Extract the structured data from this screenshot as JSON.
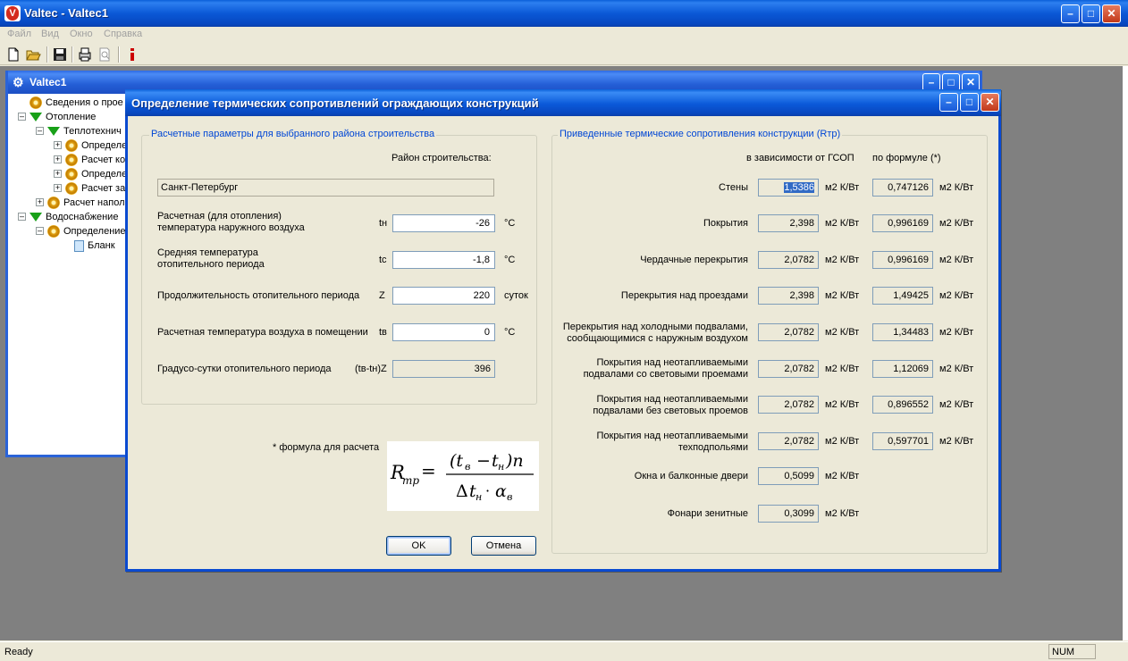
{
  "app": {
    "title": "Valtec - Valtec1",
    "menu": [
      "Файл",
      "Вид",
      "Окно",
      "Справка"
    ],
    "status_ready": "Ready",
    "status_num": "NUM"
  },
  "child": {
    "title": "Valtec1",
    "tree": [
      {
        "label": "Сведения о прое",
        "icon": "gear-icon"
      },
      {
        "label": "Отопление",
        "icon": "triangle-icon"
      },
      {
        "label": "Теплотехнич",
        "icon": "triangle-icon"
      },
      {
        "label": "Определе",
        "icon": "gear-icon"
      },
      {
        "label": "Расчет ко",
        "icon": "gear-icon"
      },
      {
        "label": "Определе",
        "icon": "gear-icon"
      },
      {
        "label": "Расчет за",
        "icon": "gear-icon"
      },
      {
        "label": "Расчет напол",
        "icon": "gear-icon"
      },
      {
        "label": "Водоснабжение",
        "icon": "triangle-icon"
      },
      {
        "label": "Определение",
        "icon": "gear-icon"
      },
      {
        "label": "Бланк",
        "icon": "document-icon"
      }
    ]
  },
  "dialog": {
    "title": "Определение термических сопротивлений ограждающих конструкций",
    "left_group": {
      "legend": "Расчетные параметры для выбранного района строительства",
      "region_label": "Район строительства:",
      "region_value": "Санкт-Петербург",
      "params": [
        {
          "label1": "Расчетная (для отопления)",
          "label2": "температура наружного воздуха",
          "sym": "tн",
          "value": "-26",
          "unit": "°C"
        },
        {
          "label1": "Средняя температура",
          "label2": "отопительного периода",
          "sym": "tc",
          "value": "-1,8",
          "unit": "°C"
        },
        {
          "label1": "Продолжительность отопительного периода",
          "label2": "",
          "sym": "Z",
          "value": "220",
          "unit": "суток"
        },
        {
          "label1": "Расчетная температура воздуха в помещении",
          "label2": "",
          "sym": "tв",
          "value": "0",
          "unit": "°C"
        },
        {
          "label1": "Градусо-сутки отопительного периода",
          "label2": "",
          "sym": "(tв-tн)Z",
          "value": "396",
          "unit": ""
        }
      ],
      "formula_note": "* формула для расчета"
    },
    "right_group": {
      "legend": "Приведенные термические сопротивления конструкции (Rтр)",
      "col1_header": "в зависимости от ГСОП",
      "col2_header": "по формуле (*)",
      "unit": "м2 К/Вт",
      "rows": [
        {
          "label1": "Стены",
          "label2": "",
          "gsop": "1,5386",
          "formula": "0,747126"
        },
        {
          "label1": "Покрытия",
          "label2": "",
          "gsop": "2,398",
          "formula": "0,996169"
        },
        {
          "label1": "Чердачные перекрытия",
          "label2": "",
          "gsop": "2,0782",
          "formula": "0,996169"
        },
        {
          "label1": "Перекрытия над проездами",
          "label2": "",
          "gsop": "2,398",
          "formula": "1,49425"
        },
        {
          "label1": "Перекрытия над холодными подвалами,",
          "label2": "сообщающимися с наружным воздухом",
          "gsop": "2,0782",
          "formula": "1,34483"
        },
        {
          "label1": "Покрытия над неотапливаемыми",
          "label2": "подвалами со световыми проемами",
          "gsop": "2,0782",
          "formula": "1,12069"
        },
        {
          "label1": "Покрытия над неотапливаемыми",
          "label2": "подвалами без световых проемов",
          "gsop": "2,0782",
          "formula": "0,896552"
        },
        {
          "label1": "Покрытия над неотапливаемыми",
          "label2": "техподпольями",
          "gsop": "2,0782",
          "formula": "0,597701"
        },
        {
          "label1": "Окна и балконные двери",
          "label2": "",
          "gsop": "0,5099",
          "formula": ""
        },
        {
          "label1": "Фонари зенитные",
          "label2": "",
          "gsop": "0,3099",
          "formula": ""
        }
      ]
    },
    "ok_label": "OK",
    "cancel_label": "Отмена"
  }
}
